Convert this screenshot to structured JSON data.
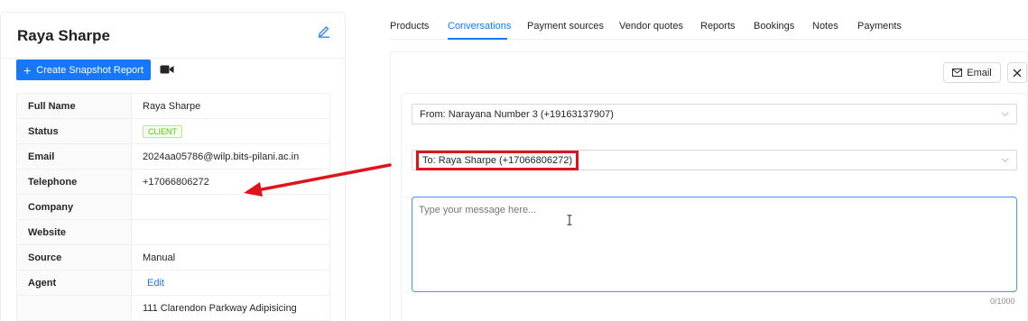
{
  "contact": {
    "name": "Raya Sharpe",
    "create_button_label": "Create Snapshot Report",
    "rows": [
      {
        "label": "Full Name",
        "value": "Raya Sharpe"
      },
      {
        "label": "Status",
        "value": "CLIENT"
      },
      {
        "label": "Email",
        "value": "2024aa05786@wilp.bits-pilani.ac.in"
      },
      {
        "label": "Telephone",
        "value": "+17066806272"
      },
      {
        "label": "Company",
        "value": ""
      },
      {
        "label": "Website",
        "value": ""
      },
      {
        "label": "Source",
        "value": "Manual"
      },
      {
        "label": "Agent",
        "value": "Edit"
      },
      {
        "label": "",
        "value": "111 Clarendon Parkway Adipisicing"
      }
    ]
  },
  "tabs": [
    {
      "label": "Products"
    },
    {
      "label": "Conversations"
    },
    {
      "label": "Payment sources"
    },
    {
      "label": "Vendor quotes"
    },
    {
      "label": "Reports"
    },
    {
      "label": "Bookings"
    },
    {
      "label": "Notes"
    },
    {
      "label": "Payments"
    }
  ],
  "active_tab": "Conversations",
  "conversation": {
    "email_button_label": "Email",
    "from_value": "From: Narayana Number 3 (+19163137907)",
    "to_value": "To: Raya Sharpe (+17066806272)",
    "message_placeholder": "Type your message here...",
    "char_count": "0/1000"
  },
  "colors": {
    "primary": "#1677ff",
    "annotation_red": "#e0131a",
    "client_tag_green": "#52c41a"
  },
  "icons": {
    "edit": "pencil-icon",
    "video": "video-camera-icon",
    "email": "mail-icon",
    "close": "close-icon",
    "dropdown": "chevron-down-icon",
    "cursor": "text-cursor-icon"
  }
}
